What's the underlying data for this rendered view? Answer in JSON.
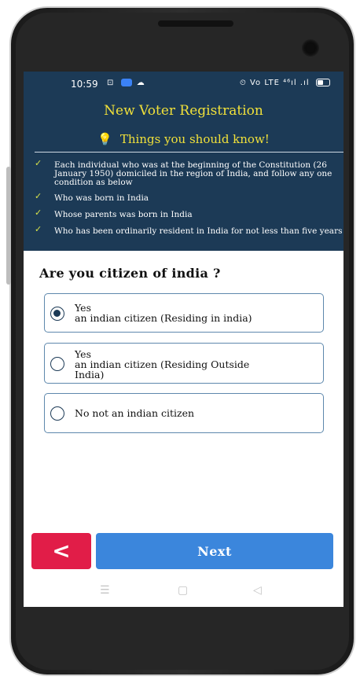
{
  "status_bar": {
    "time": "10:59",
    "left_icons": [
      "sim-icon",
      "chat-icon",
      "cloud-icon"
    ],
    "right_icons": "⏲ Vo LTE ⁴⁶ıl .ıl"
  },
  "header": {
    "title": "New Voter Registration",
    "subtitle": "Things you should know!",
    "accent_color": "#f0e03a",
    "background_color": "#1c3a56"
  },
  "info_items": [
    "Each individual who was at the beginning of the Constitution (26 January 1950) domiciled in the region of India, and follow any one condition as below",
    "Who was born in India",
    "Whose parents was born in India",
    "Who has been ordinarily resident in India for not less than five years"
  ],
  "question": "Are you citizen of india ?",
  "options": [
    {
      "label": "Yes\n an indian citizen (Residing in india)",
      "selected": true
    },
    {
      "label": "Yes\n an indian citizen (Residing Outside\nIndia)",
      "selected": false
    },
    {
      "label": "No not an indian citizen",
      "selected": false
    }
  ],
  "footer": {
    "back_icon": "chevron-left-icon",
    "back_color": "#e11d48",
    "next_label": "Next",
    "next_color": "#3b86dc"
  },
  "nav_bar": {
    "icons": [
      "menu-icon",
      "home-icon",
      "back-triangle-icon"
    ]
  }
}
